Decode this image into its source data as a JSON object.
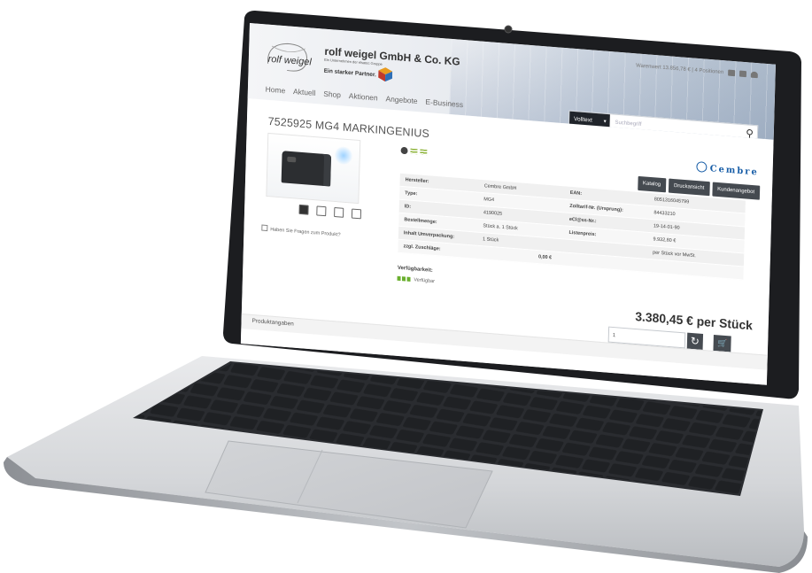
{
  "header": {
    "company_name": "rolf weigel GmbH & Co. KG",
    "company_sub": "Ein Unternehmen der elsatec Gruppe",
    "slogan": "Ein starker Partner.",
    "logo_text": "rolf weigel",
    "cart_info": "Warenwert 13.856,78 € | 4 Positionen"
  },
  "nav": [
    "Home",
    "Aktuell",
    "Shop",
    "Aktionen",
    "Angebote",
    "E-Business"
  ],
  "search": {
    "type_label": "Volltext",
    "placeholder": "Suchbegriff"
  },
  "product": {
    "title": "7525925 MG4 MARKINGENIUS",
    "brand": "Cembre",
    "question_link": "Haben Sie Fragen zum Produkt?",
    "price": "3.380,45 € per Stück",
    "quantity": "1",
    "section_tab": "Produktangaben"
  },
  "buttons": [
    "Katalog",
    "Druckansicht",
    "Kundenangebot"
  ],
  "details_left": [
    {
      "label": "Hersteller:",
      "value": "Cembre GmbH"
    },
    {
      "label": "Type:",
      "value": "MG4"
    },
    {
      "label": "ID:",
      "value": "4190025"
    },
    {
      "label": "Bestellmenge:",
      "value": "Stück a. 1 Stück"
    },
    {
      "label": "Inhalt Umverpackung:",
      "value": "1 Stück"
    }
  ],
  "details_right": [
    {
      "label": "EAN:",
      "value": "8051316045799"
    },
    {
      "label": "Zolltarif-Nr. (Ursprung):",
      "value": "84433210"
    },
    {
      "label": "eCl@ss-Nr.:",
      "value": "19-14-01-90"
    },
    {
      "label": "Listenpreis:",
      "value": "9.932,80 €"
    },
    {
      "label": "",
      "value": "per Stück vor MwSt."
    }
  ],
  "surcharge": {
    "label": "zzgl. Zuschläge:",
    "value": "0,00 €"
  },
  "availability": {
    "label": "Verfügbarkeit:",
    "status": "Verfügbar"
  }
}
